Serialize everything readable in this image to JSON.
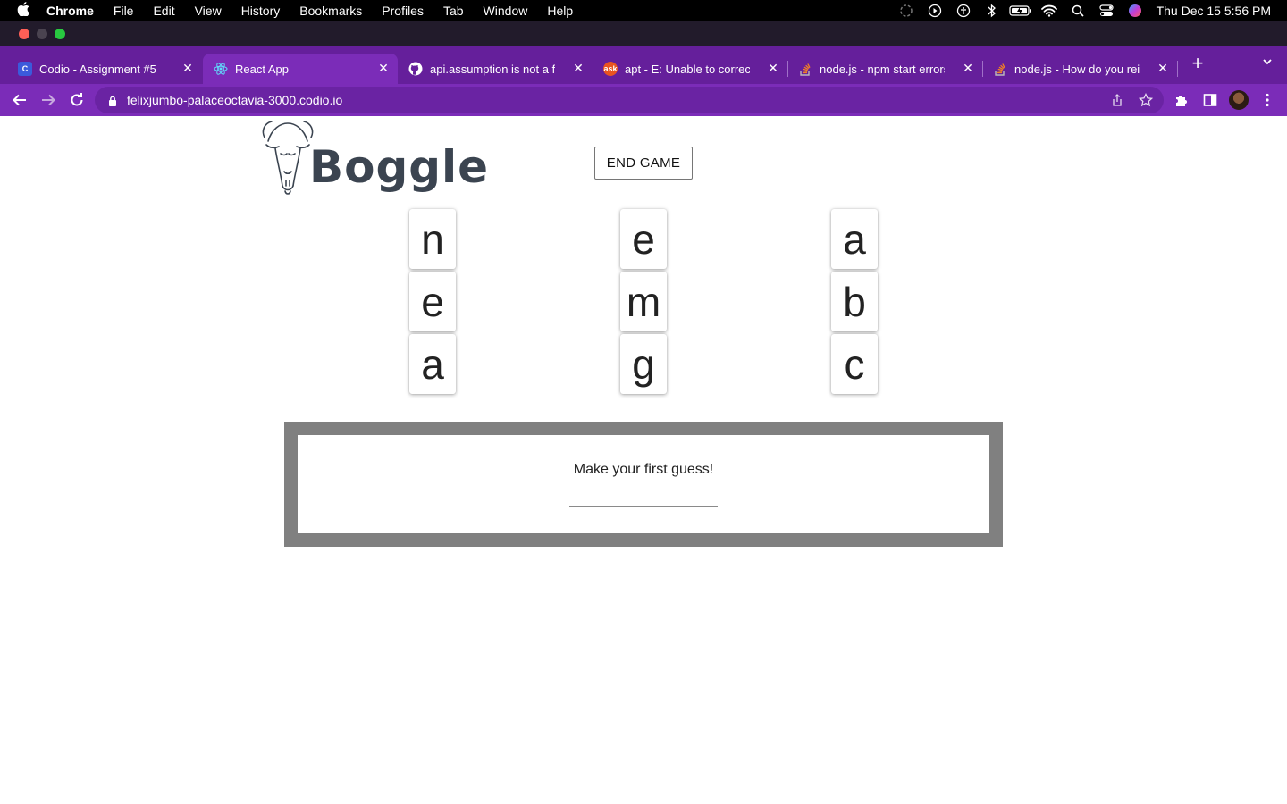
{
  "menubar": {
    "app": "Chrome",
    "items": [
      "File",
      "Edit",
      "View",
      "History",
      "Bookmarks",
      "Profiles",
      "Tab",
      "Window",
      "Help"
    ],
    "clock": "Thu Dec 15  5:56 PM"
  },
  "tabs": [
    {
      "title": "Codio - Assignment #5",
      "favicon": "codio-icon",
      "color": "#3b5bdb"
    },
    {
      "title": "React App",
      "favicon": "react-icon",
      "color": "#61dafb"
    },
    {
      "title": "api.assumption is not a fun",
      "favicon": "github-icon",
      "color": "#ffffff"
    },
    {
      "title": "apt - E: Unable to correct p",
      "favicon": "askubuntu-icon",
      "color": "#e95420"
    },
    {
      "title": "node.js - npm start errors w",
      "favicon": "stackoverflow-icon",
      "color": "#f48024"
    },
    {
      "title": "node.js - How do you reinsta",
      "favicon": "stackoverflow-icon",
      "color": "#f48024"
    }
  ],
  "address_bar": {
    "url": "felixjumbo-palaceoctavia-3000.codio.io"
  },
  "app": {
    "logo_text": "Boggle",
    "end_button": "END GAME",
    "board": [
      [
        "n",
        "e",
        "a"
      ],
      [
        "e",
        "m",
        "b"
      ],
      [
        "a",
        "g",
        "c"
      ]
    ],
    "guess_prompt": "Make your first guess!",
    "guess_value": ""
  },
  "colors": {
    "tab_strip": "#651f9b",
    "toolbar": "#7b2cb8",
    "guess_frame": "#808080"
  }
}
